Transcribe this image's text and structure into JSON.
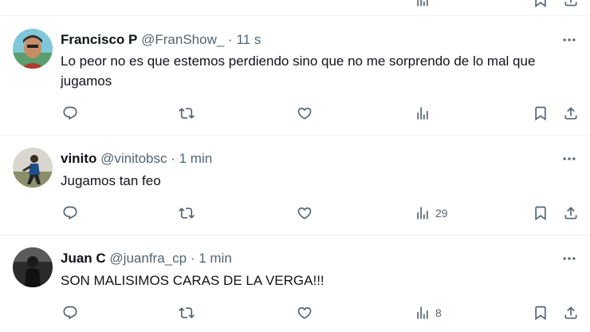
{
  "tweets": [
    {
      "name": "Francisco P",
      "handle": "@FranShow_",
      "dot": "·",
      "time": "11 s",
      "text": "Lo peor no es que estemos perdiendo sino que no me sorprendo de lo mal que jugamos",
      "views": ""
    },
    {
      "name": "vinito",
      "handle": "@vinitobsc",
      "dot": "·",
      "time": "1 min",
      "text": "Jugamos tan feo",
      "views": "29"
    },
    {
      "name": "Juan C",
      "handle": "@juanfra_cp",
      "dot": "·",
      "time": "1 min",
      "text": "SON MALISIMOS CARAS DE LA VERGA!!!",
      "views": "8"
    }
  ],
  "icons": {
    "reply": "reply-icon",
    "repost": "repost-icon",
    "like": "like-icon",
    "views": "views-icon",
    "bookmark": "bookmark-icon",
    "share": "share-icon",
    "more": "more-icon"
  },
  "colors": {
    "text": "#0f1419",
    "secondary": "#536471",
    "divider": "#eff3f4"
  }
}
